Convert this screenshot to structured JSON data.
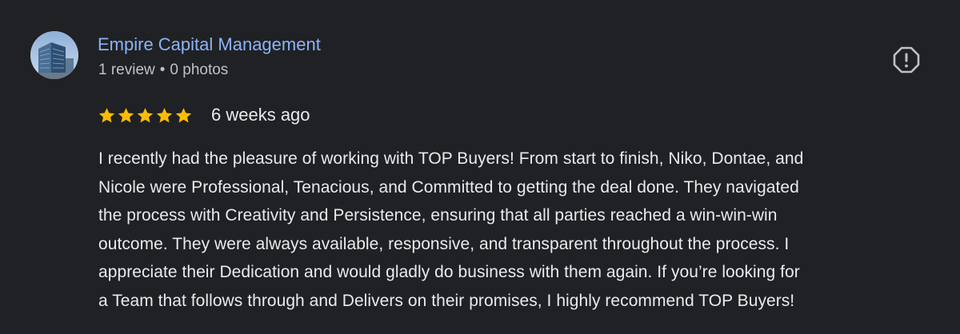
{
  "review": {
    "author": "Empire Capital Management",
    "review_count": "1 review",
    "separator": "•",
    "photo_count": "0 photos",
    "rating": 5,
    "rating_max": 5,
    "star_color": "#fbbc04",
    "time_ago": "6 weeks ago",
    "report_icon": "report-flag-icon",
    "text_lines": [
      "I recently had the pleasure of working with TOP Buyers! From start to finish, Niko, Dontae, and",
      "Nicole were Professional, Tenacious, and Committed to getting the deal done. They navigated",
      "the process with Creativity and Persistence, ensuring that all parties reached a win-win-win",
      "outcome. They were always available, responsive, and transparent throughout the process. I",
      "appreciate their Dedication and would gladly do business with them again. If you’re looking for",
      "a Team that follows through and Delivers on their promises, I highly recommend TOP Buyers!"
    ]
  },
  "colors": {
    "background": "#202124",
    "author_link": "#8ab4f8",
    "secondary_text": "#bdc1c6",
    "primary_text": "#e8eaed"
  }
}
